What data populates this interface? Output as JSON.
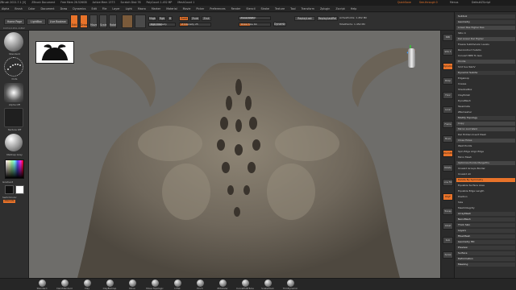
{
  "titlebar": {
    "items": [
      "ZBrush 2021.7.1 [V]",
      "ZBrush Document",
      "Free Mem 26.526GB",
      "Active Mem 1373",
      "Scratch Disk 76",
      "PolyCount 1.452 MP",
      "MeshCount 1"
    ],
    "quicksave": "QuickSave",
    "seethrough": "See-through 0",
    "menus_label": "Menus",
    "default_zscript": "DefaultZScript"
  },
  "menubar": [
    "Alpha",
    "Brush",
    "Color",
    "Document",
    "Draw",
    "Dynamics",
    "Edit",
    "File",
    "Layer",
    "Light",
    "Macro",
    "Marker",
    "Material",
    "Movie",
    "Picker",
    "Preferences",
    "Render",
    "Stencil",
    "Stroke",
    "Texture",
    "Tool",
    "Transform",
    "Zplugin",
    "Zscript",
    "Help"
  ],
  "topbar": {
    "home_page": "Home Page",
    "lightbox": "LightBox",
    "live_boolean": "Live Boolean",
    "edit": "Edit",
    "draw": "Draw",
    "move": "Move",
    "scale": "Scale",
    "rotate": "Rotate",
    "mrgb": "Mrgb",
    "rgb": "Rgb",
    "m": "M",
    "zadd": "Zadd",
    "zsub": "Zsub",
    "zcut": "Zcut",
    "rgb_intensity": "Rgb Intensity",
    "z_intensity": "Z Intensity 25",
    "focal_shift": "Focal Shift 0",
    "draw_size": "Draw Size 64",
    "dynamic": "Dynamic",
    "replay_last": "ReplayLast",
    "replay_last_rel": "ReplayLastRel",
    "active_points": "ActivePoints: 1.452 Mil",
    "total_points": "TotalPoints: 1.452 Mil",
    "coords": "0.674,0.254,-0.862"
  },
  "lefttray": {
    "tools": [
      "Standard",
      "Dots",
      "Alpha Off",
      "Texture Off",
      "MatCap Gray"
    ],
    "switch_color": "SwitchColor",
    "gradient": "Gradient",
    "alternate": "Alternate"
  },
  "rightshelf": [
    "BPR",
    "SPix 3",
    "Dynamic",
    "Persp",
    "Floor",
    "Local",
    "Frame",
    "Move",
    "Zoom3D",
    "Rotate",
    "Line Fill",
    "PolyF",
    "Transp",
    "Ghost",
    "Solo",
    "Xpose"
  ],
  "rightpanel": {
    "sections": [
      {
        "label": "Subtool",
        "type": "hdr"
      },
      {
        "label": "Geometry",
        "type": "hdr"
      },
      {
        "label": "Lower Res   Higher Res",
        "type": "btnrow"
      },
      {
        "label": "SDiv 4",
        "type": "row"
      },
      {
        "label": "Del Lower   Del Higher",
        "type": "btnrow"
      },
      {
        "label": "Freeze SubDivision Levels",
        "type": "row"
      },
      {
        "label": "Reconstruct Subdiv",
        "type": "row"
      },
      {
        "label": "Convert BPR To Geo",
        "type": "row"
      },
      {
        "label": "Divide",
        "type": "btnrow"
      },
      {
        "label": "Smt   Suv   ReUV",
        "type": "row"
      },
      {
        "label": "Dynamic Subdiv",
        "type": "hdr"
      },
      {
        "label": "Edgeloop",
        "type": "row"
      },
      {
        "label": "Crease",
        "type": "row"
      },
      {
        "label": "ShadowBox",
        "type": "row"
      },
      {
        "label": "ClayPolish",
        "type": "row"
      },
      {
        "label": "DynaMesh",
        "type": "row"
      },
      {
        "label": "Tessimate",
        "type": "row"
      },
      {
        "label": "ZRemesher",
        "type": "row"
      },
      {
        "label": "Modify Topology",
        "type": "hdr"
      },
      {
        "label": "Copy",
        "type": "btnrow"
      },
      {
        "label": "Mirror And Weld",
        "type": "btnrow"
      },
      {
        "label": "Del Hidden   Insert Mesh",
        "type": "row"
      },
      {
        "label": "Close Holes",
        "type": "btnrow"
      },
      {
        "label": "Weld Points",
        "type": "row"
      },
      {
        "label": "Spin Edge   Align Edge",
        "type": "row"
      },
      {
        "label": "Micro Mesh",
        "type": "row"
      },
      {
        "label": "Optimize Points   MergeTris",
        "type": "btnrow"
      },
      {
        "label": "Unweld Groups Border",
        "type": "row"
      },
      {
        "label": "Unweld All",
        "type": "row"
      },
      {
        "label": "Delete By Symmetry",
        "type": "orange"
      },
      {
        "label": "Equalize Surface Area",
        "type": "row"
      },
      {
        "label": "Equalize Edge Length",
        "type": "row"
      },
      {
        "label": "Position",
        "type": "row"
      },
      {
        "label": "Size",
        "type": "row"
      },
      {
        "label": "MeshIntegrity",
        "type": "row"
      },
      {
        "label": "ArrayMesh",
        "type": "hdr"
      },
      {
        "label": "NanoMesh",
        "type": "hdr"
      },
      {
        "label": "Thick Skin",
        "type": "hdr"
      },
      {
        "label": "Layers",
        "type": "hdr"
      },
      {
        "label": "FiberMesh",
        "type": "hdr"
      },
      {
        "label": "Geometry HD",
        "type": "hdr"
      },
      {
        "label": "Preview",
        "type": "hdr"
      },
      {
        "label": "Surface",
        "type": "hdr"
      },
      {
        "label": "Deformation",
        "type": "hdr"
      },
      {
        "label": "Masking",
        "type": "hdr"
      }
    ]
  },
  "bottomtray": [
    "Standard",
    "DamStandard",
    "Clay",
    "ClayBuildup",
    "Move",
    "Move Topologic",
    "Inflat",
    "Pinch",
    "ZModeler",
    "CurveMultiTube",
    "SnakeHook",
    "TrimDynamic"
  ],
  "colors": {
    "accent": "#e8732a",
    "clay": "#7d7467",
    "background": "#6e6d6a"
  }
}
